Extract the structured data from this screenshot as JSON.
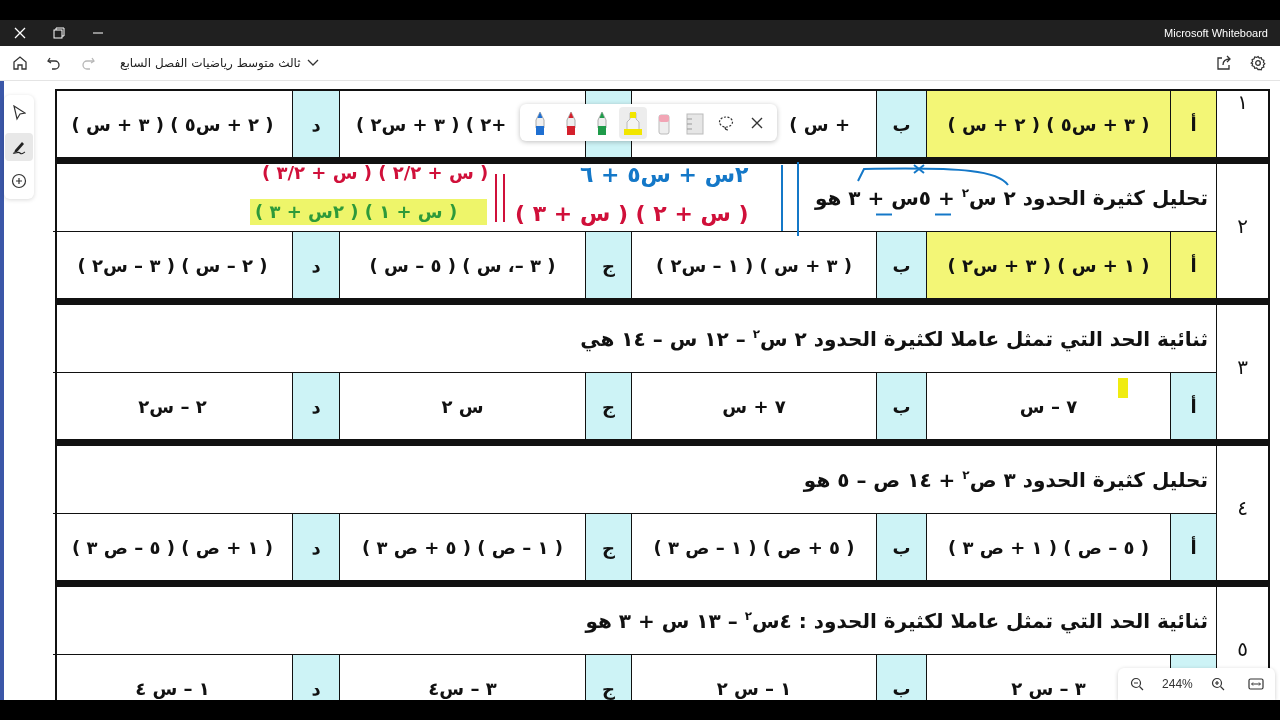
{
  "titlebar": {
    "app_name": "Microsoft Whiteboard"
  },
  "toolbar": {
    "board_title": "ثالث متوسط رياضيات الفصل السابع",
    "redo_disabled": true
  },
  "left_tools": [
    {
      "kind": "select",
      "selected": false
    },
    {
      "kind": "ink",
      "selected": true
    },
    {
      "kind": "add",
      "selected": false
    }
  ],
  "questions": [
    {
      "number": "١",
      "options": [
        {
          "letter": "أ",
          "text": "( س + ٢ ) ( ٥س + ٣ )",
          "highlighted": true
        },
        {
          "letter": "ب",
          "text": "( س +",
          "highlighted": false
        },
        {
          "text": "( ٢س + ٣ ) ( ٢+",
          "highlighted": false
        },
        {
          "letter": "د",
          "text": "( س + ٣ ) ( ٥س + ٢ )",
          "highlighted": false
        }
      ]
    },
    {
      "number": "٢",
      "question": "تحليل كثيرة الحدود ٢ س$^{٢}$ + ٥س + ٣ هو",
      "options": [
        {
          "letter": "أ",
          "text": "( ٢س + ٣ ) ( س + ١ )",
          "highlighted": true
        },
        {
          "letter": "ب",
          "text": "( ٢س – ١ ) ( س + ٣ )",
          "highlighted": false
        },
        {
          "letter": "ج",
          "text": "( س – ٥ ) ( س ،– ٣ )",
          "highlighted": false
        },
        {
          "letter": "د",
          "text": "( ٢س – ٣ ) ( س – ٢ )",
          "highlighted": false
        }
      ]
    },
    {
      "number": "٣",
      "question": "ثنائية الحد التي تمثل عاملا لكثيرة الحدود  ٢ س$^{٢}$ – ١٢ س – ١٤ هي",
      "options": [
        {
          "letter": "أ",
          "text": "س – ٧",
          "highlighted": false
        },
        {
          "letter": "ب",
          "text": "س + ٧",
          "highlighted": false
        },
        {
          "letter": "ج",
          "text": "٢ س",
          "highlighted": false
        },
        {
          "letter": "د",
          "text": "٢س – ٢",
          "highlighted": false
        }
      ]
    },
    {
      "number": "٤",
      "question": "تحليل كثيرة الحدود ٣ ص$^{٢}$ + ١٤ ص – ٥  هو",
      "options": [
        {
          "letter": "أ",
          "text": "( ٣ ص + ١ ) ( ص – ٥ )",
          "highlighted": false
        },
        {
          "letter": "ب",
          "text": "( ٣ ص – ١ ) ( ص + ٥ )",
          "highlighted": false
        },
        {
          "letter": "ج",
          "text": "( ٣ ص + ٥ ) ( ص – ١ )",
          "highlighted": false
        },
        {
          "letter": "د",
          "text": "( ٣ ص – ٥ ) ( ص + ١ )",
          "highlighted": false
        }
      ]
    },
    {
      "number": "٥",
      "question": "ثنائية الحد التي تمثل عاملا لكثيرة الحدود :  ٤س$^{٢}$ – ١٣ س + ٣  هو",
      "options": [
        {
          "text": "٢ س – ٣",
          "highlighted": false
        },
        {
          "letter": "ب",
          "text": "٢ س – ١",
          "highlighted": false
        },
        {
          "letter": "ج",
          "text": "٤س – ٣",
          "highlighted": false
        },
        {
          "letter": "د",
          "text": "٤ س – ١",
          "highlighted": false
        }
      ]
    }
  ],
  "ink": [
    {
      "text": "٦ + ٥س + س٢",
      "color": "#1478c8",
      "highlighted": false
    },
    {
      "text": "( ٣/٢ + س ) ( ٢/٢ + س )",
      "color": "#d0103a",
      "highlighted": false
    },
    {
      "text": "( ٣ + س ) ( ٢ + س )",
      "color": "#d0103a",
      "highlighted": false
    },
    {
      "text": "( ٣ + س٢ ) ( ١ + س )",
      "color": "#2e9a3a",
      "highlighted": true
    }
  ],
  "ink_toolbar": [
    {
      "kind": "pen",
      "color": "#1f6fd1",
      "selected": false
    },
    {
      "kind": "pen",
      "color": "#d4202c",
      "selected": false
    },
    {
      "kind": "pen",
      "color": "#1f9b4a",
      "selected": false
    },
    {
      "kind": "highlighter",
      "color": "#f2e600",
      "selected": true
    },
    {
      "kind": "eraser",
      "selected": false
    },
    {
      "kind": "ruler",
      "selected": false
    },
    {
      "kind": "lasso",
      "selected": false
    }
  ],
  "zoom": {
    "level_text": "244%"
  }
}
